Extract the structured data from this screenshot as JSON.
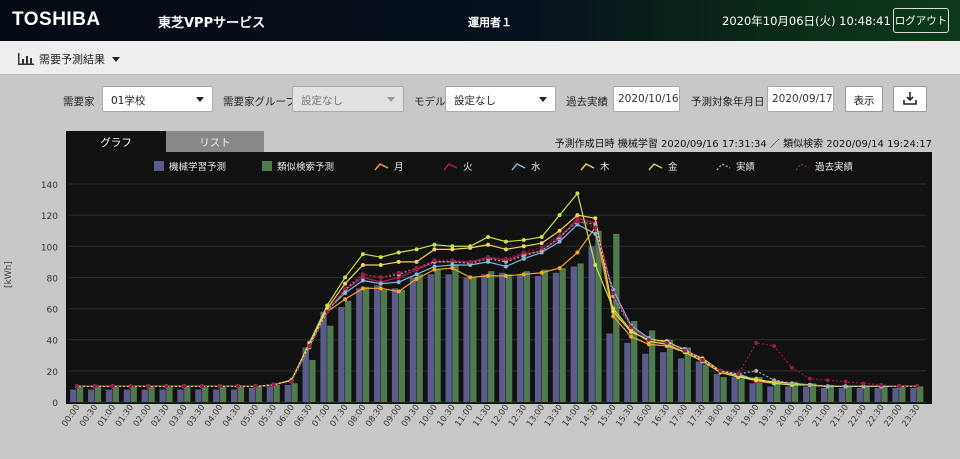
{
  "header": {
    "logo": "TOSHIBA",
    "app_name": "東芝VPPサービス",
    "operator": "運用者１",
    "datetime": "2020年10月06日(火) 10:48:41",
    "logout_label": "ログアウト"
  },
  "subbar": {
    "menu_label": "需要予測結果"
  },
  "filters": {
    "consumer_label": "需要家",
    "consumer_value": "01学校",
    "group_label": "需要家グループ",
    "group_value": "設定なし",
    "model_label": "モデル",
    "model_value": "設定なし",
    "past_label": "過去実績",
    "past_value": "2020/10/16",
    "target_label": "予測対象年月日",
    "target_value": "2020/09/17",
    "show_label": "表示"
  },
  "tabs": {
    "graph": "グラフ",
    "list": "リスト"
  },
  "prediction_info": "予測作成日時 機械学習 2020/09/16 17:31:34 ／ 類似検索 2020/09/14 19:24:17",
  "colors": {
    "ml": "#5c5c8c",
    "sim": "#4e7a4e",
    "mon": "#f5a623",
    "tue": "#c0185a",
    "wed": "#7fb8e0",
    "thu": "#f2d35e",
    "fri": "#c8e04a",
    "actual": "#aaaaaa",
    "past": "#a01848"
  },
  "chart_data": {
    "type": "bar",
    "ylabel": "[kWh]",
    "ylim": [
      0,
      140
    ],
    "yticks": [
      0,
      20,
      40,
      60,
      80,
      100,
      120,
      140
    ],
    "categories": [
      "00:00",
      "00:30",
      "01:00",
      "01:30",
      "02:00",
      "02:30",
      "03:00",
      "03:30",
      "04:00",
      "04:30",
      "05:00",
      "05:30",
      "06:00",
      "06:30",
      "07:00",
      "07:30",
      "08:00",
      "08:30",
      "09:00",
      "09:30",
      "10:00",
      "10:30",
      "11:00",
      "11:30",
      "12:00",
      "12:30",
      "13:00",
      "13:30",
      "14:00",
      "14:30",
      "15:00",
      "15:30",
      "16:00",
      "16:30",
      "17:00",
      "17:30",
      "18:00",
      "18:30",
      "19:00",
      "19:30",
      "20:00",
      "20:30",
      "21:00",
      "21:30",
      "22:00",
      "22:30",
      "23:00",
      "23:30"
    ],
    "series": [
      {
        "name": "機械学習予測",
        "kind": "bar",
        "values": [
          8,
          8,
          8,
          8,
          8,
          8,
          8,
          8,
          8,
          8,
          9,
          10,
          11,
          35,
          58,
          61,
          73,
          75,
          73,
          80,
          82,
          82,
          80,
          82,
          83,
          82,
          81,
          83,
          87,
          100,
          44,
          38,
          31,
          32,
          28,
          26,
          18,
          16,
          12,
          10,
          10,
          10,
          9,
          9,
          9,
          9,
          9,
          9
        ]
      },
      {
        "name": "類似検索予測",
        "kind": "bar",
        "values": [
          10,
          10,
          10,
          10,
          10,
          10,
          10,
          10,
          10,
          10,
          10,
          11,
          12,
          27,
          49,
          65,
          74,
          72,
          72,
          82,
          85,
          88,
          80,
          84,
          82,
          84,
          85,
          86,
          89,
          110,
          108,
          52,
          46,
          40,
          35,
          24,
          16,
          15,
          16,
          14,
          13,
          12,
          11,
          10,
          10,
          10,
          10,
          10
        ]
      },
      {
        "name": "月",
        "kind": "line",
        "values": [
          10,
          10,
          10,
          10,
          10,
          10,
          10,
          10,
          10,
          10,
          10,
          11,
          14,
          36,
          58,
          66,
          73,
          73,
          71,
          79,
          85,
          86,
          80,
          81,
          81,
          82,
          83,
          86,
          96,
          112,
          55,
          42,
          37,
          36,
          32,
          26,
          19,
          16,
          15,
          12,
          11,
          11,
          10,
          10,
          10,
          10,
          10,
          10
        ]
      },
      {
        "name": "火",
        "kind": "line",
        "values": [
          10,
          10,
          10,
          10,
          10,
          10,
          10,
          10,
          10,
          10,
          10,
          11,
          14,
          37,
          59,
          72,
          80,
          77,
          80,
          85,
          90,
          90,
          90,
          93,
          91,
          95,
          97,
          105,
          118,
          115,
          70,
          48,
          40,
          39,
          33,
          27,
          19,
          17,
          13,
          12,
          11,
          11,
          10,
          10,
          10,
          10,
          10,
          10
        ]
      },
      {
        "name": "水",
        "kind": "line",
        "values": [
          10,
          10,
          10,
          10,
          10,
          10,
          10,
          10,
          10,
          10,
          10,
          11,
          14,
          36,
          59,
          70,
          78,
          76,
          77,
          82,
          87,
          88,
          88,
          90,
          87,
          92,
          96,
          103,
          114,
          108,
          72,
          49,
          41,
          38,
          34,
          26,
          20,
          18,
          14,
          12,
          11,
          11,
          10,
          10,
          10,
          10,
          10,
          10
        ]
      },
      {
        "name": "木",
        "kind": "line",
        "values": [
          10,
          10,
          10,
          10,
          10,
          10,
          10,
          10,
          10,
          10,
          10,
          11,
          14,
          37,
          60,
          76,
          88,
          88,
          90,
          90,
          98,
          98,
          99,
          101,
          98,
          100,
          102,
          110,
          120,
          118,
          58,
          45,
          40,
          39,
          33,
          28,
          20,
          17,
          14,
          13,
          12,
          11,
          10,
          10,
          10,
          10,
          10,
          10
        ]
      },
      {
        "name": "金",
        "kind": "line",
        "values": [
          10,
          10,
          10,
          10,
          10,
          10,
          10,
          10,
          10,
          10,
          10,
          11,
          14,
          38,
          62,
          80,
          95,
          93,
          96,
          98,
          101,
          100,
          100,
          106,
          103,
          104,
          106,
          120,
          134,
          88,
          60,
          46,
          39,
          37,
          32,
          27,
          19,
          16,
          14,
          12,
          11,
          11,
          10,
          10,
          10,
          10,
          10,
          10
        ]
      },
      {
        "name": "実績",
        "kind": "line",
        "values": [
          10,
          10,
          10,
          10,
          10,
          10,
          10,
          10,
          10,
          10,
          10,
          11,
          13,
          35,
          58,
          72,
          82,
          80,
          82,
          86,
          90,
          90,
          89,
          92,
          90,
          94,
          97,
          106,
          116,
          114,
          68,
          48,
          40,
          38,
          33,
          27,
          20,
          18,
          20,
          14,
          12,
          11,
          10,
          10,
          10,
          10,
          10,
          10
        ]
      },
      {
        "name": "過去実績",
        "kind": "line",
        "values": [
          10,
          10,
          10,
          10,
          10,
          10,
          10,
          10,
          10,
          10,
          10,
          11,
          13,
          36,
          58,
          73,
          82,
          80,
          83,
          86,
          91,
          91,
          90,
          93,
          92,
          96,
          99,
          107,
          116,
          112,
          70,
          48,
          40,
          38,
          33,
          27,
          20,
          18,
          38,
          36,
          22,
          15,
          14,
          13,
          12,
          11,
          10,
          10
        ]
      }
    ]
  }
}
